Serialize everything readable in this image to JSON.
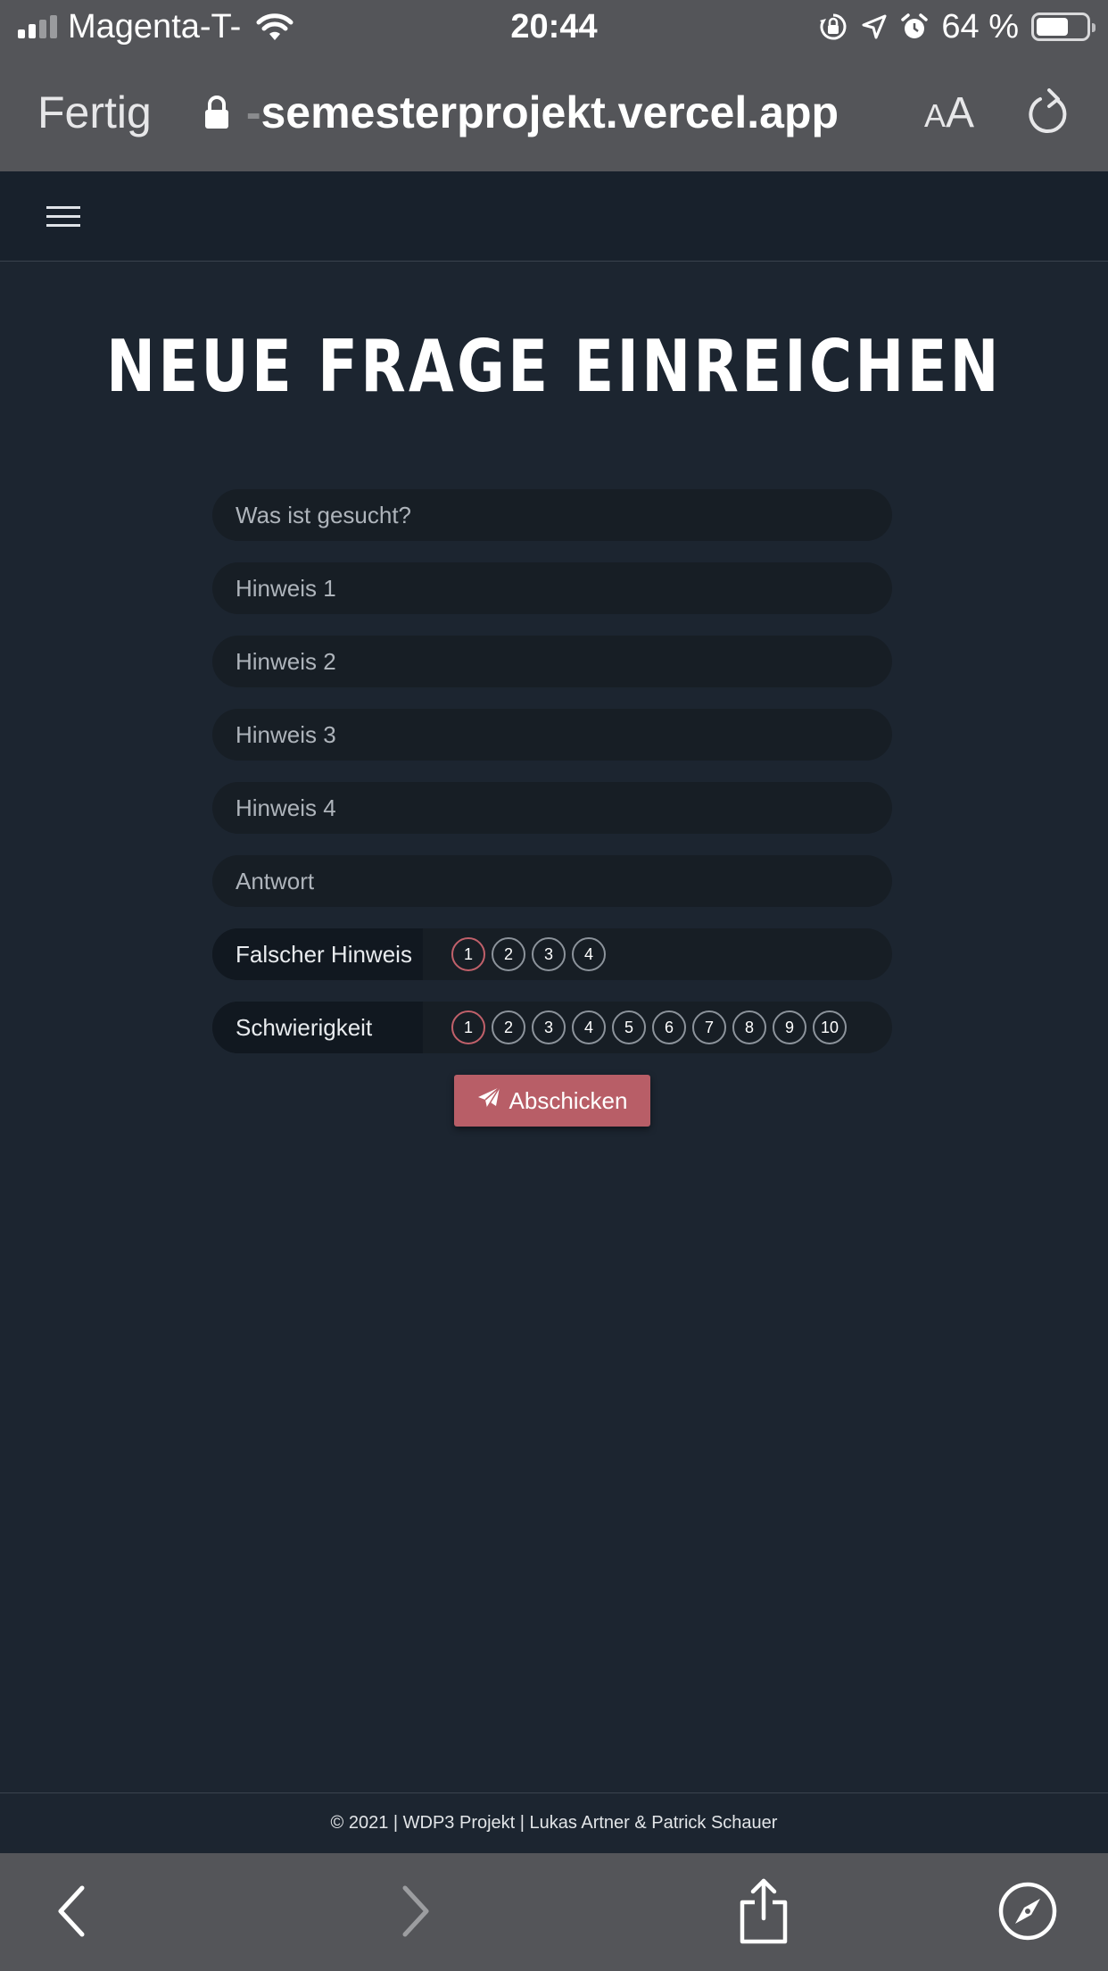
{
  "status_bar": {
    "carrier": "Magenta-T-",
    "time": "20:44",
    "battery": "64 %"
  },
  "browser": {
    "done_label": "Fertig",
    "url_prefix": "-",
    "url": "semesterprojekt.vercel.app",
    "text_size_small": "A",
    "text_size_large": "A"
  },
  "page": {
    "title": "NEUE FRAGE EINREICHEN"
  },
  "form": {
    "question_placeholder": "Was ist gesucht?",
    "hint1_placeholder": "Hinweis 1",
    "hint2_placeholder": "Hinweis 2",
    "hint3_placeholder": "Hinweis 3",
    "hint4_placeholder": "Hinweis 4",
    "answer_placeholder": "Antwort",
    "wrong_hint": {
      "label": "Falscher Hinweis",
      "options": [
        "1",
        "2",
        "3",
        "4"
      ],
      "selected": "1"
    },
    "difficulty": {
      "label": "Schwierigkeit",
      "options": [
        "1",
        "2",
        "3",
        "4",
        "5",
        "6",
        "7",
        "8",
        "9",
        "10"
      ],
      "selected": "1"
    },
    "submit_label": "Abschicken"
  },
  "footer": {
    "text": "© 2021 | WDP3 Projekt | Lukas Artner & Patrick Schauer"
  },
  "colors": {
    "background": "#1c2530",
    "accent": "#b85e67",
    "selected_ring": "#c0606a",
    "browser_chrome": "#545559"
  },
  "icons": [
    "signal-icon",
    "wifi-icon",
    "orientation-lock-icon",
    "location-icon",
    "alarm-icon",
    "lock-icon",
    "reload-icon",
    "hamburger-icon",
    "paper-plane-icon",
    "back-icon",
    "forward-icon",
    "share-icon",
    "compass-icon"
  ]
}
